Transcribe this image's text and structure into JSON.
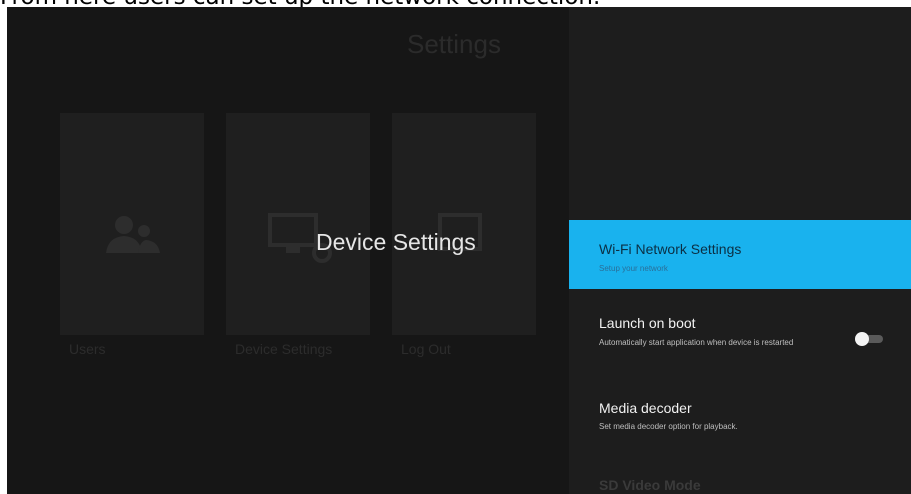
{
  "caption": "From here users can set up the network connection.",
  "background": {
    "title": "Settings",
    "tiles": [
      {
        "label": "Users",
        "icon": "users-icon"
      },
      {
        "label": "Device Settings",
        "icon": "device-settings-icon"
      },
      {
        "label": "Log Out",
        "icon": "logout-icon"
      }
    ]
  },
  "overlay_title": "Device Settings",
  "panel": {
    "items": [
      {
        "title": "Wi-Fi Network Settings",
        "subtitle": "Setup your network",
        "selected": true
      },
      {
        "title": "Launch on boot",
        "subtitle": "Automatically start application when device is restarted",
        "toggle_on": false
      },
      {
        "title": "Media decoder",
        "subtitle": "Set media decoder option for playback."
      },
      {
        "title": "SD Video Mode"
      }
    ]
  },
  "colors": {
    "accent": "#19b2ee",
    "screen_bg": "#161616",
    "panel_bg": "#1d1d1d"
  }
}
